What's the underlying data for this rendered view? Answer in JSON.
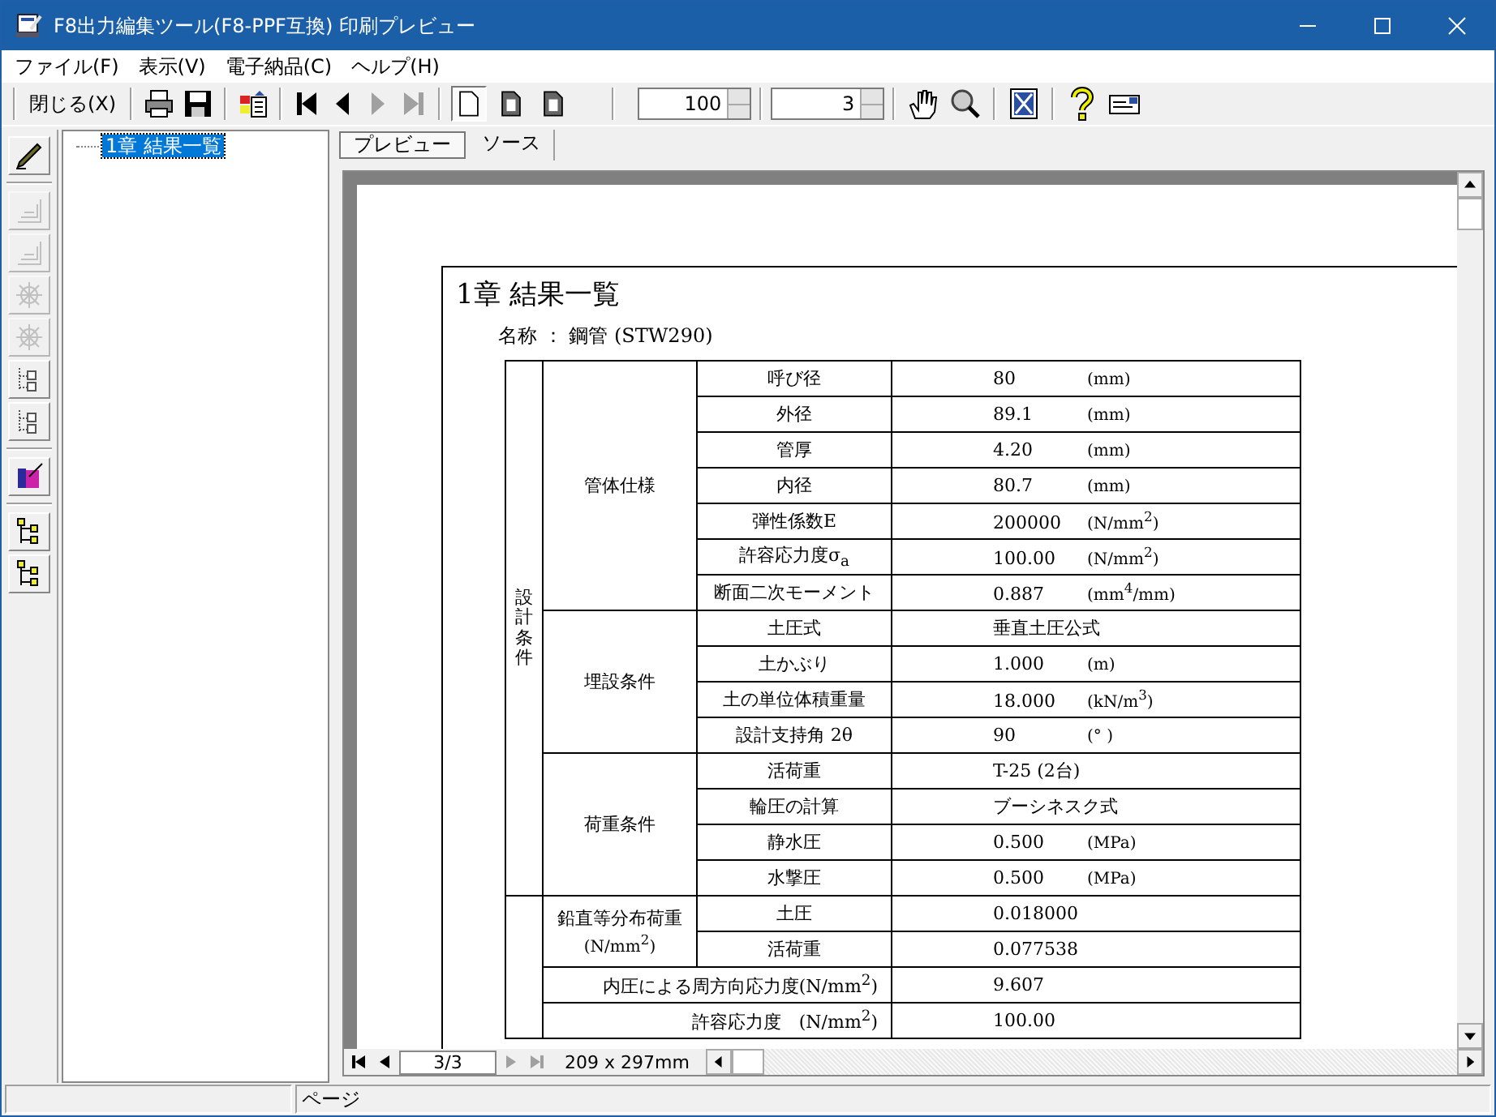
{
  "window": {
    "title": "F8出力編集ツール(F8-PPF互換) 印刷プレビュー"
  },
  "menu": [
    "ファイル(F)",
    "表示(V)",
    "電子納品(C)",
    "ヘルプ(H)"
  ],
  "toolbar": {
    "close_button": "閉じる(X)",
    "nav_buttons": [
      {
        "disabled": false
      },
      {
        "disabled": false
      },
      {
        "disabled": true
      },
      {
        "disabled": true
      }
    ],
    "page_buttons": [
      {
        "selected": true
      },
      {
        "selected": false
      },
      {
        "selected": false
      }
    ],
    "zoom": "100",
    "page": "3"
  },
  "left_tools": [
    {
      "disabled": false
    },
    {
      "disabled": true
    },
    {
      "disabled": true
    },
    {
      "disabled": true
    },
    {
      "disabled": true
    },
    {
      "disabled": false
    },
    {
      "disabled": false
    },
    {
      "disabled": false
    },
    {
      "disabled": false
    },
    {
      "disabled": false
    }
  ],
  "tree": [
    {
      "label": "1章 結果一覧",
      "selected": true
    }
  ],
  "tabs": [
    {
      "label": "プレビュー",
      "selected": true
    },
    {
      "label": "ソース",
      "selected": false
    }
  ],
  "document": {
    "heading": "1章 結果一覧",
    "name_line": "名称 ： 鋼管 (STW290)",
    "sections": [
      {
        "label": "設計条件",
        "groups": [
          {
            "label": "管体仕様",
            "rows": [
              {
                "item": "呼び径",
                "value": "80",
                "unit": "(mm)"
              },
              {
                "item": "外径",
                "value": "89.1",
                "unit": "(mm)"
              },
              {
                "item": "管厚",
                "value": "4.20",
                "unit": "(mm)"
              },
              {
                "item": "内径",
                "value": "80.7",
                "unit": "(mm)"
              },
              {
                "item": "弾性係数E",
                "value": "200000",
                "unit": "(N/mm$^{2}$)"
              },
              {
                "item": "許容応力度σ$_{a}$",
                "value": "100.00",
                "unit": "(N/mm$^{2}$)"
              },
              {
                "item": "断面二次モーメント",
                "value": "0.887",
                "unit": "(mm$^{4}$/mm)"
              }
            ]
          },
          {
            "label": "埋設条件",
            "rows": [
              {
                "item": "土圧式",
                "value": "垂直土圧公式"
              },
              {
                "item": "土かぶり",
                "value": "1.000",
                "unit": "(m)"
              },
              {
                "item": "土の単位体積重量",
                "value": "18.000",
                "unit": "(kN/m$^{3}$)"
              },
              {
                "item": "設計支持角 2θ",
                "value": "90",
                "unit": "(° )"
              }
            ]
          },
          {
            "label": "荷重条件",
            "rows": [
              {
                "item": "活荷重",
                "value": "T-25 (2台)"
              },
              {
                "item": "輪圧の計算",
                "value": "ブーシネスク式"
              },
              {
                "item": "静水圧",
                "value": "0.500",
                "unit": "(MPa)"
              },
              {
                "item": "水撃圧",
                "value": "0.500",
                "unit": "(MPa)"
              }
            ]
          }
        ]
      },
      {
        "groups": [
          {
            "label": "鉛直等分布荷重",
            "sublabel": "(N/mm$^{2}$)",
            "rows": [
              {
                "item": "土圧",
                "value": "0.018000"
              },
              {
                "item": "活荷重",
                "value": "0.077538"
              }
            ]
          },
          {
            "label": "内圧による周方向応力度(N/mm$^{2}$)",
            "rows": [
              {
                "value": "9.607"
              }
            ]
          },
          {
            "label": "許容応力度　(N/mm$^{2}$)",
            "rows": [
              {
                "value": "100.00"
              }
            ]
          }
        ]
      }
    ]
  },
  "pager": {
    "page": "3/3",
    "nav_buttons": [
      {
        "disabled": false
      },
      {
        "disabled": false
      },
      {
        "disabled": true
      },
      {
        "disabled": true
      }
    ],
    "paper_size": "209 x 297mm"
  },
  "status_bar": [
    "ページ"
  ]
}
